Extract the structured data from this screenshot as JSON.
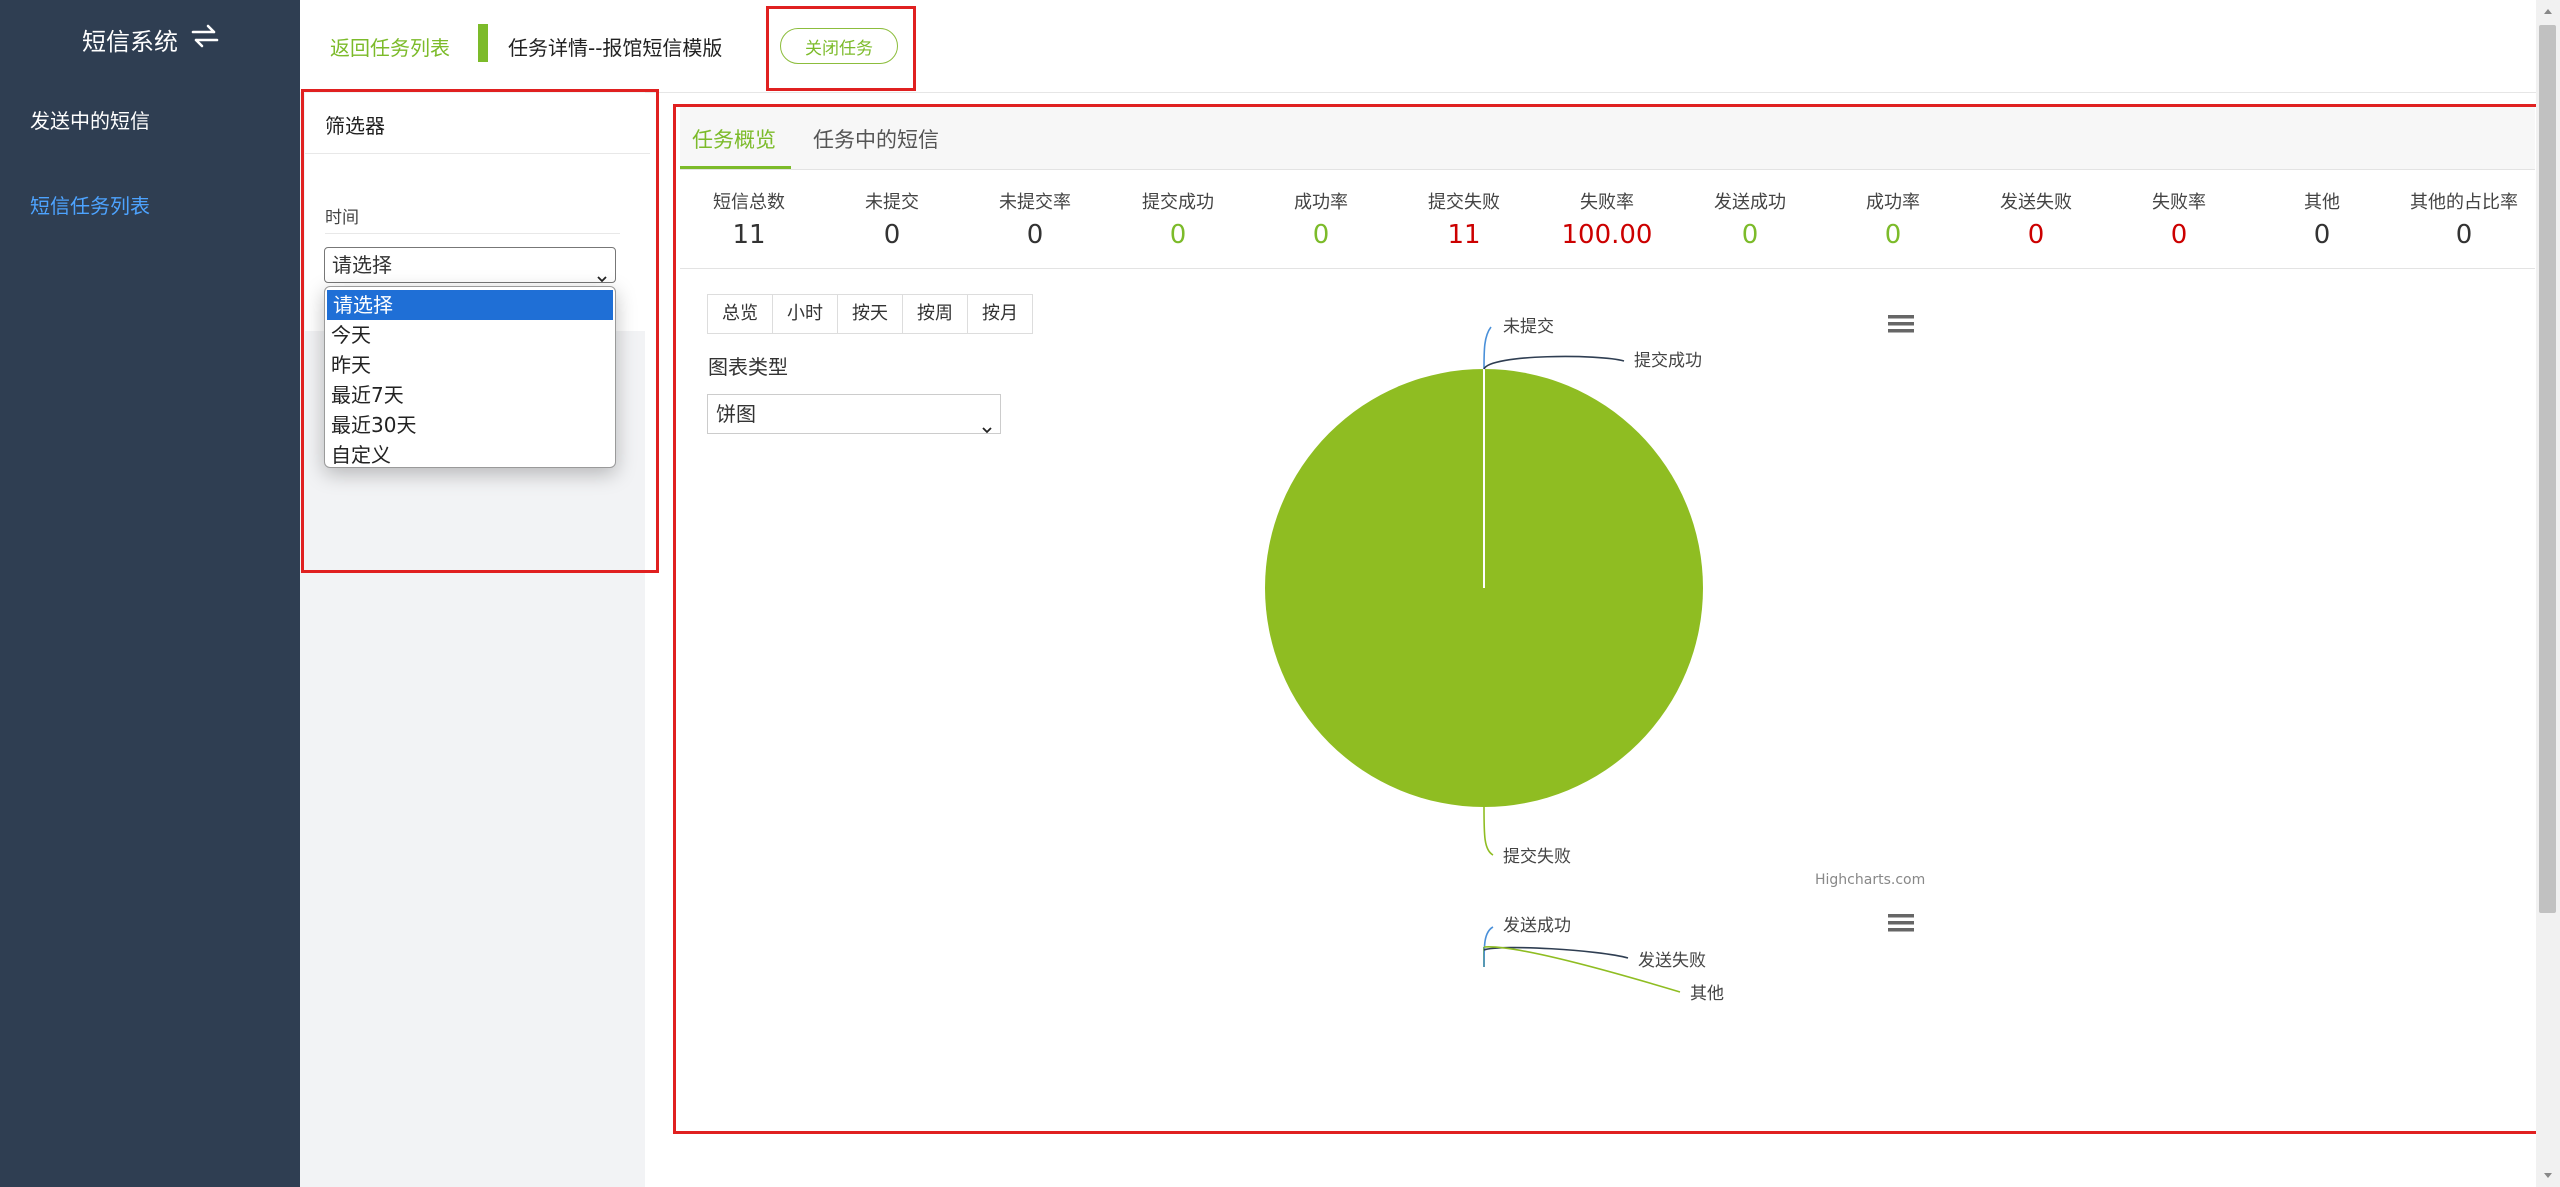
{
  "sidebar": {
    "title": "短信系统",
    "items": [
      {
        "label": "发送中的短信"
      },
      {
        "label": "短信任务列表",
        "active": true
      }
    ],
    "colors": {
      "background": "#2f3e52",
      "active": "#4da3ff"
    }
  },
  "header": {
    "back_link": "返回任务列表",
    "task_title": "任务详情--报馆短信模版",
    "close_button": "关闭任务"
  },
  "filter": {
    "title": "筛选器",
    "time_label": "时间",
    "time_select_value": "请选择",
    "options": [
      "请选择",
      "今天",
      "昨天",
      "最近7天",
      "最近30天",
      "自定义"
    ]
  },
  "tabs": [
    {
      "label": "任务概览",
      "active": true
    },
    {
      "label": "任务中的短信"
    }
  ],
  "stats": [
    {
      "label": "短信总数",
      "value": "11",
      "color": "#333333"
    },
    {
      "label": "未提交",
      "value": "0",
      "color": "#333333"
    },
    {
      "label": "未提交率",
      "value": "0",
      "color": "#333333"
    },
    {
      "label": "提交成功",
      "value": "0",
      "color": "#7cbb2a"
    },
    {
      "label": "成功率",
      "value": "0",
      "color": "#7cbb2a"
    },
    {
      "label": "提交失败",
      "value": "11",
      "color": "#cc0000"
    },
    {
      "label": "失败率",
      "value": "100.00",
      "color": "#cc0000"
    },
    {
      "label": "发送成功",
      "value": "0",
      "color": "#7cbb2a"
    },
    {
      "label": "成功率",
      "value": "0",
      "color": "#7cbb2a"
    },
    {
      "label": "发送失败",
      "value": "0",
      "color": "#cc0000"
    },
    {
      "label": "失败率",
      "value": "0",
      "color": "#cc0000"
    },
    {
      "label": "其他",
      "value": "0",
      "color": "#333333"
    },
    {
      "label": "其他的占比率",
      "value": "0",
      "color": "#333333"
    }
  ],
  "view_buttons": [
    "总览",
    "小时",
    "按天",
    "按周",
    "按月"
  ],
  "chart_type": {
    "label": "图表类型",
    "value": "饼图"
  },
  "highcharts_credit": "Highcharts.com",
  "chart_data": [
    {
      "type": "pie",
      "categories": [
        "未提交",
        "提交成功",
        "提交失败"
      ],
      "values": [
        0,
        0,
        11
      ],
      "colors": [
        "#4a90d9",
        "#2f3e52",
        "#8fbd22"
      ]
    },
    {
      "type": "pie",
      "categories": [
        "发送成功",
        "发送失败",
        "其他"
      ],
      "values": [
        0,
        0,
        0
      ],
      "colors": [
        "#4a90d9",
        "#2f3e52",
        "#8fbd22"
      ]
    }
  ]
}
